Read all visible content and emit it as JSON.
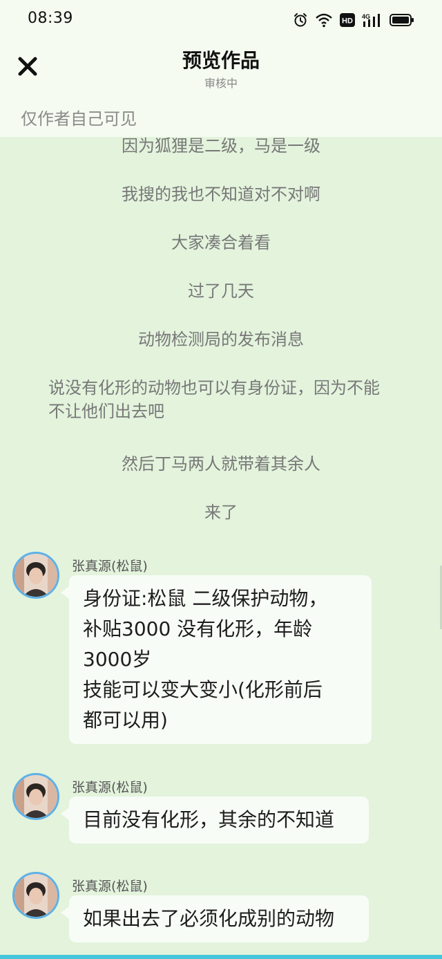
{
  "status_bar": {
    "time": "08:39",
    "icons": [
      "alarm-icon",
      "wifi-icon",
      "hd-icon",
      "signal-4g-icon",
      "battery-icon"
    ],
    "hd_label": "HD",
    "network_label": "4G"
  },
  "header": {
    "close_icon": "close-icon",
    "title": "预览作品",
    "subtitle": "审核中",
    "visibility": "仅作者自己可见"
  },
  "narrations": [
    "因为狐狸是二级，马是一级",
    "我搜的我也不知道对不对啊",
    "大家凑合着看",
    "过了几天",
    "动物检测局的发布消息",
    "说没有化形的动物也可以有身份证，因为不能不让他们出去吧",
    "然后丁马两人就带着其余人",
    "来了"
  ],
  "messages": [
    {
      "speaker": "张真源(松鼠)",
      "lines": [
        "身份证:松鼠 二级保护动物，",
        "补贴3000 没有化形，年龄",
        "3000岁",
        "技能可以变大变小(化形前后",
        "都可以用)"
      ]
    },
    {
      "speaker": "张真源(松鼠)",
      "lines": [
        "目前没有化形，其余的不知道"
      ]
    },
    {
      "speaker": "张真源(松鼠)",
      "lines": [
        "如果出去了必须化成别的动物"
      ]
    }
  ],
  "colors": {
    "background": "#e3f3dc",
    "header_bg": "#f5fbf1",
    "bubble_bg": "#f8fcf6",
    "avatar_ring": "#5db1e8",
    "bottom_accent": "#46c6dc"
  }
}
